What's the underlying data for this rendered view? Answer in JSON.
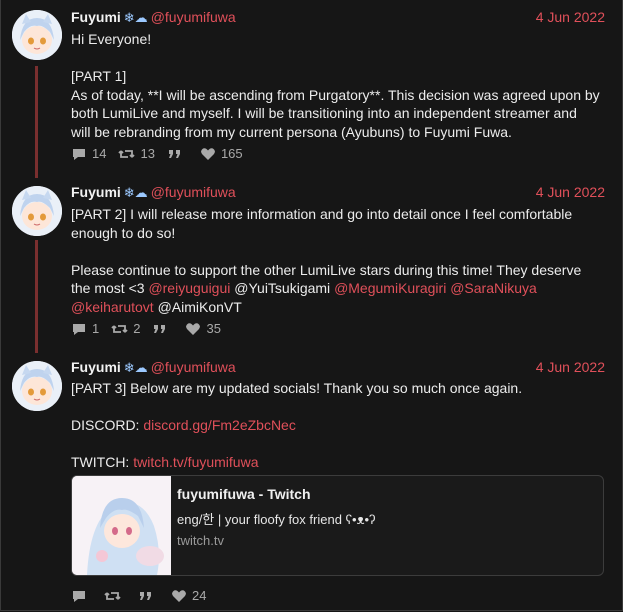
{
  "tweets": [
    {
      "name": "Fuyumi",
      "emoji": "❄☁",
      "handle": "@fuyumifuwa",
      "date": "4 Jun 2022",
      "lines": [
        "Hi Everyone!",
        "",
        "[PART 1]",
        "As of today, **I will be ascending from Purgatory**. This decision was agreed upon by",
        "both LumiLive and myself. I will be transitioning into an independent streamer and",
        "will be rebranding from my current persona (Ayubuns) to Fuyumi Fuwa."
      ],
      "replies": "14",
      "retweets": "13",
      "likes": "165"
    },
    {
      "name": "Fuyumi",
      "emoji": "❄☁",
      "handle": "@fuyumifuwa",
      "date": "4 Jun 2022",
      "line1": "[PART 2] I will release more information and go into detail once I feel comfortable",
      "line2": "enough to do so!",
      "line3": "Please continue to support the other LumiLive stars during this time! They deserve",
      "line4_prefix": "the most <3 ",
      "mentions": [
        "@reiyuguigui",
        "@YuiTsukigami",
        "@MegumiKuragiri",
        "@SaraNikuya",
        "@keiharutovt",
        "@AimiKonVT"
      ],
      "replies": "1",
      "retweets": "2",
      "likes": "35"
    },
    {
      "name": "Fuyumi",
      "emoji": "❄☁",
      "handle": "@fuyumifuwa",
      "date": "4 Jun 2022",
      "line1": "[PART 3] Below are my updated socials! Thank you so much once again.",
      "discord_label": "DISCORD: ",
      "discord_link": "discord.gg/Fm2eZbcNec",
      "twitch_label": "TWITCH: ",
      "twitch_link": "twitch.tv/fuyumifuwa",
      "card": {
        "title": "fuyumifuwa - Twitch",
        "description": "eng/한 | your floofy fox friend ʕ•ᴥ•ʔ",
        "domain": "twitch.tv"
      },
      "replies": "",
      "retweets": "",
      "likes": "24"
    }
  ],
  "colors": {
    "accent": "#e0505a",
    "background": "#161616",
    "thread_line": "#7a2f2f"
  }
}
